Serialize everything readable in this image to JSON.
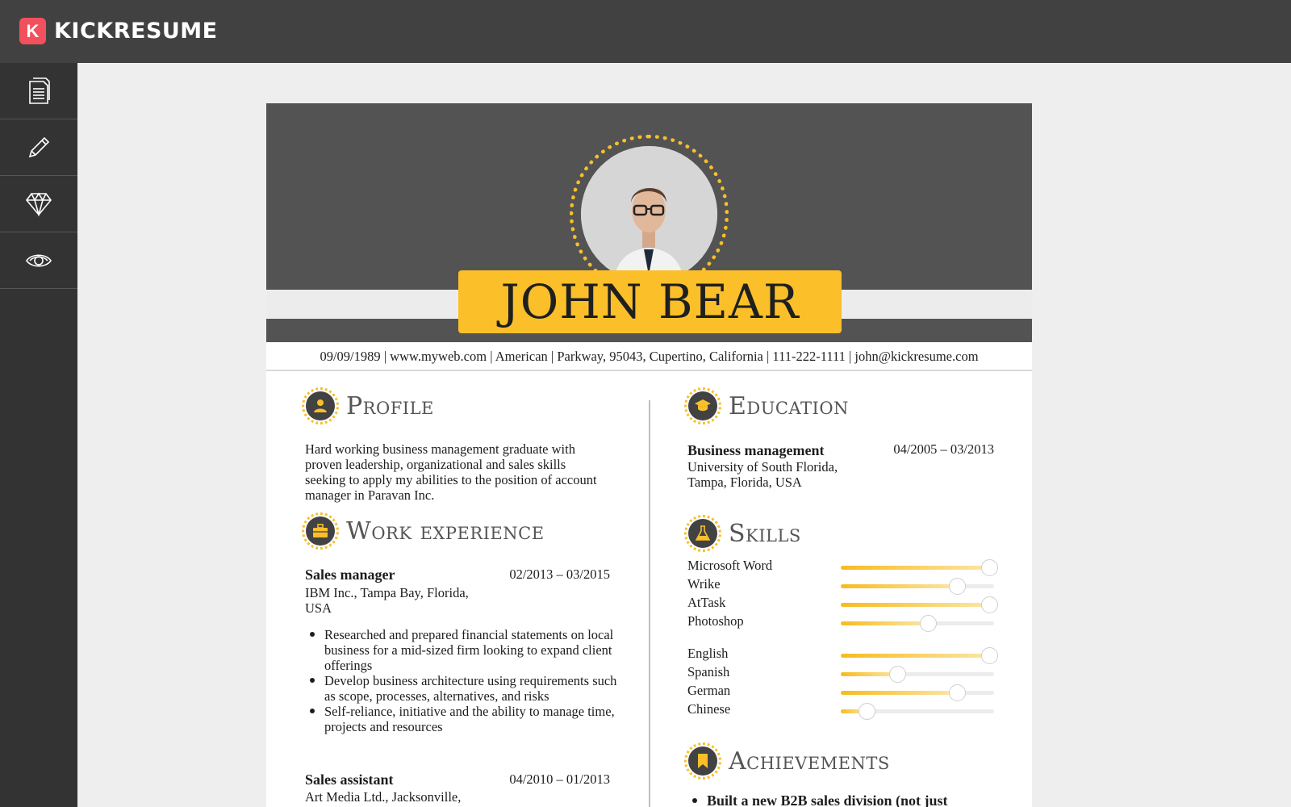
{
  "app": {
    "logo_letter": "K",
    "name": "KICKRESUME"
  },
  "sidebar": {
    "items": [
      {
        "icon": "document-icon",
        "name": "sidebar-item-document"
      },
      {
        "icon": "pencil-icon",
        "name": "sidebar-item-edit"
      },
      {
        "icon": "diamond-icon",
        "name": "sidebar-item-templates"
      },
      {
        "icon": "eye-icon",
        "name": "sidebar-item-preview"
      }
    ]
  },
  "resume": {
    "name": "JOHN BEAR",
    "contact": "09/09/1989 | www.myweb.com | American | Parkway, 95043, Cupertino, California | 111-222-1111 | john@kickresume.com",
    "profile": {
      "title": "Profile",
      "text": "Hard working business management graduate with proven leadership, organizational and sales skills seeking to apply my abilities to the position of account manager in Paravan Inc."
    },
    "work": {
      "title": "Work experience",
      "jobs": [
        {
          "role": "Sales manager",
          "dates": "02/2013 – 03/2015",
          "company": "IBM Inc., Tampa Bay, Florida, USA",
          "bullets": [
            "Researched and prepared financial statements on local business for a mid-sized firm looking to expand client offerings",
            "Develop business architecture using requirements such as scope, processes, alternatives, and risks",
            "Self-reliance, initiative and the ability to manage time, projects and resources"
          ]
        },
        {
          "role": "Sales assistant",
          "dates": "04/2010 – 01/2013",
          "company": "Art Media Ltd., Jacksonville, Florida, USA"
        }
      ]
    },
    "education": {
      "title": "Education",
      "degree": "Business management",
      "dates": "04/2005 – 03/2013",
      "school": "University of South Florida, Tampa, Florida, USA"
    },
    "skills": {
      "title": "Skills",
      "items": [
        {
          "name": "Microsoft Word",
          "level": 0.97
        },
        {
          "name": "Wrike",
          "level": 0.76
        },
        {
          "name": "AtTask",
          "level": 0.97
        },
        {
          "name": "Photoshop",
          "level": 0.57
        }
      ],
      "languages": [
        {
          "name": "English",
          "level": 0.97
        },
        {
          "name": "Spanish",
          "level": 0.37
        },
        {
          "name": "German",
          "level": 0.76
        },
        {
          "name": "Chinese",
          "level": 0.17
        }
      ]
    },
    "achievements": {
      "title": "Achievements",
      "first": "Built a new B2B sales division (not just"
    }
  },
  "colors": {
    "accent": "#fbbf2a",
    "dark": "#414141",
    "brand": "#f2505c"
  }
}
